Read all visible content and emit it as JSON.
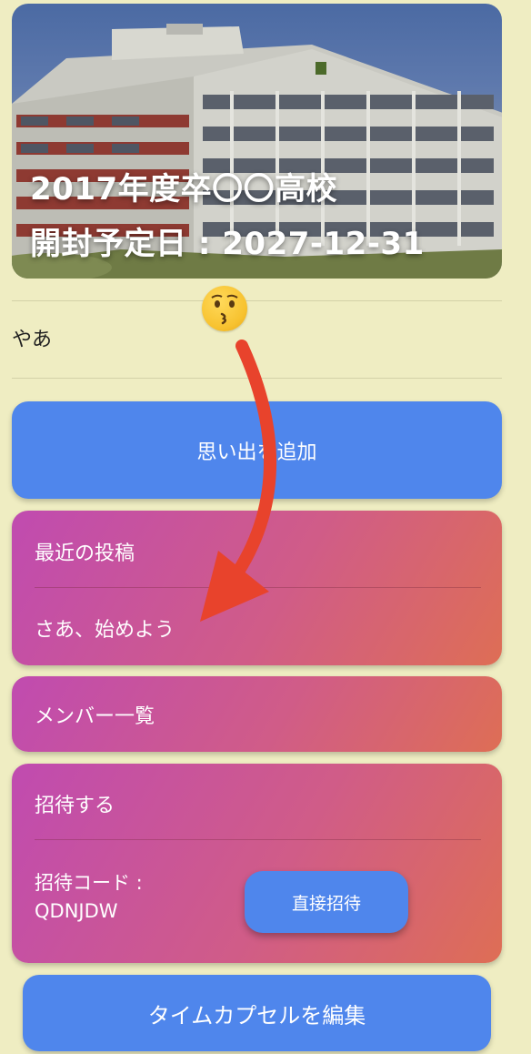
{
  "header": {
    "title_line1": "2017年度卒〇〇高校",
    "title_line2": "開封予定日 : 2027-12-31"
  },
  "emoji": {
    "icon": "kissing-face-icon",
    "glyph": "😗"
  },
  "greeting": "やあ",
  "actions": {
    "add_memory": "思い出を追加",
    "edit_capsule": "タイムカプセルを編集",
    "direct_invite": "直接招待"
  },
  "recent": {
    "title": "最近の投稿",
    "empty_text": "さあ、始めよう"
  },
  "members": {
    "title": "メンバー一覧"
  },
  "invite": {
    "title": "招待する",
    "code_label": "招待コード :",
    "code_value": "QDNJDW"
  },
  "colors": {
    "background": "#efedc2",
    "button": "#4f86ec",
    "card_gradient_start": "#c04bb0",
    "card_gradient_end": "#de6e55",
    "annotation_arrow": "#e8432c"
  }
}
